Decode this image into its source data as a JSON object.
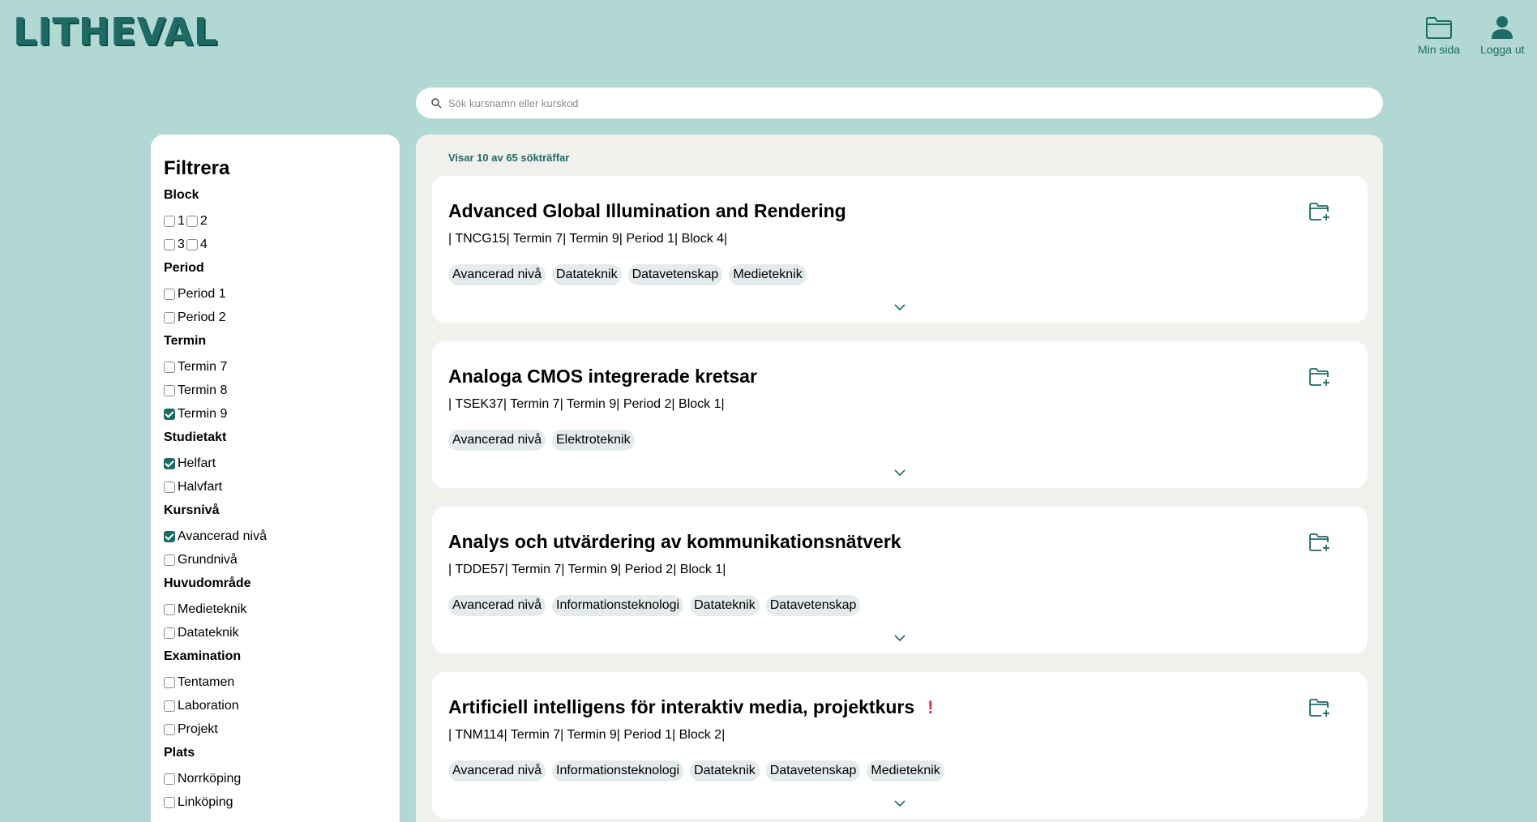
{
  "header": {
    "logo": "LITHEVAL",
    "my_page_label": "Min sida",
    "logout_label": "Logga ut"
  },
  "search": {
    "placeholder": "Sök kursnamn eller kurskod",
    "value": ""
  },
  "filters": {
    "title": "Filtrera",
    "block": {
      "title": "Block",
      "options": [
        {
          "label": "1",
          "checked": false
        },
        {
          "label": "2",
          "checked": false
        },
        {
          "label": "3",
          "checked": false
        },
        {
          "label": "4",
          "checked": false
        }
      ]
    },
    "period": {
      "title": "Period",
      "options": [
        {
          "label": "Period 1",
          "checked": false
        },
        {
          "label": "Period 2",
          "checked": false
        }
      ]
    },
    "termin": {
      "title": "Termin",
      "options": [
        {
          "label": "Termin 7",
          "checked": false
        },
        {
          "label": "Termin 8",
          "checked": false
        },
        {
          "label": "Termin 9",
          "checked": true
        }
      ]
    },
    "studietakt": {
      "title": "Studietakt",
      "options": [
        {
          "label": "Helfart",
          "checked": true
        },
        {
          "label": "Halvfart",
          "checked": false
        }
      ]
    },
    "kursniva": {
      "title": "Kursnivå",
      "options": [
        {
          "label": "Avancerad nivå",
          "checked": true
        },
        {
          "label": "Grundnivå",
          "checked": false
        }
      ]
    },
    "huvudomrade": {
      "title": "Huvudområde",
      "options": [
        {
          "label": "Medieteknik",
          "checked": false
        },
        {
          "label": "Datateknik",
          "checked": false
        }
      ]
    },
    "examination": {
      "title": "Examination",
      "options": [
        {
          "label": "Tentamen",
          "checked": false
        },
        {
          "label": "Laboration",
          "checked": false
        },
        {
          "label": "Projekt",
          "checked": false
        }
      ]
    },
    "plats": {
      "title": "Plats",
      "options": [
        {
          "label": "Norrköping",
          "checked": false
        },
        {
          "label": "Linköping",
          "checked": false
        }
      ]
    }
  },
  "results": {
    "count_text": "Visar 10 av 65 sökträffar",
    "courses": [
      {
        "title": "Advanced Global Illumination and Rendering",
        "meta": "| TNCG15| Termin 7| Termin 9| Period 1| Block 4|",
        "tags": [
          "Avancerad nivå",
          "Datateknik",
          "Datavetenskap",
          "Medieteknik"
        ],
        "warning": ""
      },
      {
        "title": "Analoga CMOS integrerade kretsar",
        "meta": "| TSEK37| Termin 7| Termin 9| Period 2| Block 1|",
        "tags": [
          "Avancerad nivå",
          "Elektroteknik"
        ],
        "warning": ""
      },
      {
        "title": "Analys och utvärdering av kommunikationsnätverk",
        "meta": "| TDDE57| Termin 7| Termin 9| Period 2| Block 1|",
        "tags": [
          "Avancerad nivå",
          "Informationsteknologi",
          "Datateknik",
          "Datavetenskap"
        ],
        "warning": ""
      },
      {
        "title": "Artificiell intelligens för interaktiv media, projektkurs",
        "meta": "| TNM114| Termin 7| Termin 9| Period 1| Block 2|",
        "tags": [
          "Avancerad nivå",
          "Informationsteknologi",
          "Datateknik",
          "Datavetenskap",
          "Medieteknik"
        ],
        "warning": "!"
      }
    ]
  },
  "colors": {
    "background": "#b2d8d4",
    "accent": "#1e6b66",
    "warning": "#e0304a",
    "tag_bg": "#e3ebec"
  }
}
